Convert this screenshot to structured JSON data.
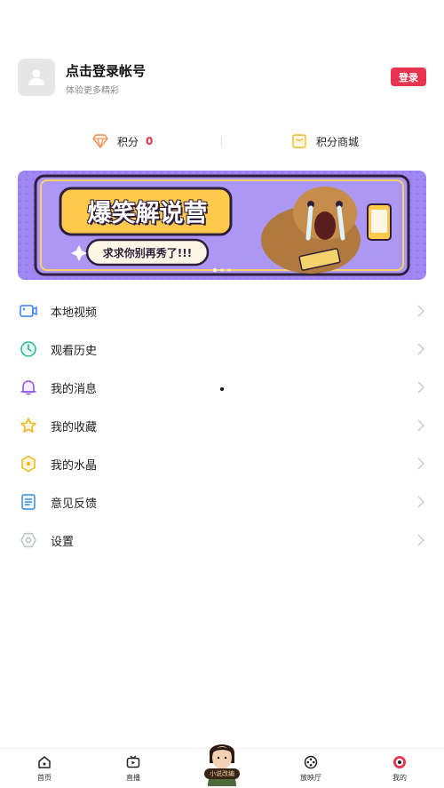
{
  "profile": {
    "title": "点击登录帐号",
    "subtitle": "体验更多精彩",
    "login_label": "登录"
  },
  "stats": {
    "points_label": "积分",
    "points_value": "0",
    "shop_label": "积分商城"
  },
  "banner": {
    "title": "爆笑解说营",
    "subtitle": "求求你别再秀了!!!"
  },
  "menu": [
    {
      "label": "本地视频",
      "icon": "local-video-icon"
    },
    {
      "label": "观看历史",
      "icon": "history-clock-icon"
    },
    {
      "label": "我的消息",
      "icon": "bell-icon"
    },
    {
      "label": "我的收藏",
      "icon": "star-icon"
    },
    {
      "label": "我的水晶",
      "icon": "crystal-icon"
    },
    {
      "label": "意见反馈",
      "icon": "feedback-icon"
    },
    {
      "label": "设置",
      "icon": "settings-icon"
    }
  ],
  "bottom_nav": {
    "home": "首页",
    "live": "直播",
    "center": "小说改编",
    "cinema": "放映厅",
    "mine": "我的"
  },
  "colors": {
    "accent": "#e8344e",
    "banner_bg": "#9f86f2",
    "banner_title_bg": "#ffc94b"
  }
}
